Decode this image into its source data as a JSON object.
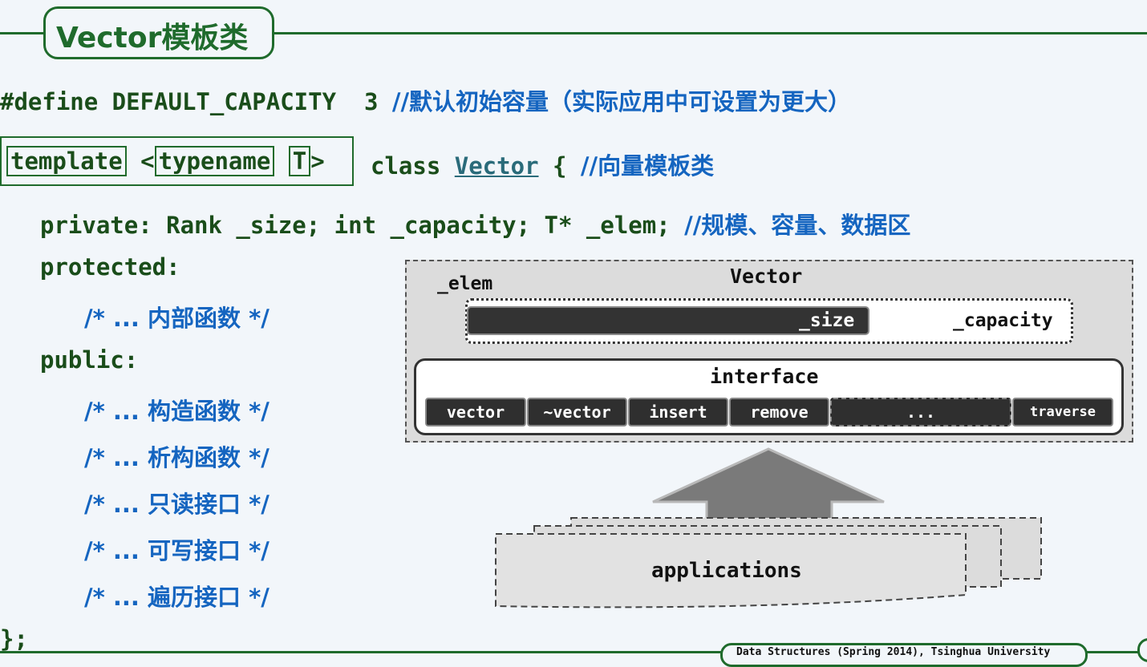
{
  "slide": {
    "title": "Vector模板类",
    "define_code": "#define DEFAULT_CAPACITY  3 ",
    "define_comment": "//默认初始容量（实际应用中可设置为更大）",
    "tpl_template": "template",
    "tpl_lt": "<",
    "tpl_typename": "typename",
    "tpl_T": "T",
    "tpl_gt": ">",
    "class_kw": "class ",
    "class_name": "Vector",
    "class_brace": " { ",
    "class_comment": "//向量模板类",
    "private_code": "private: Rank _size; int _capacity; T* _elem; ",
    "private_comment": "//规模、容量、数据区",
    "protected_kw": "protected:",
    "public_kw": "public:",
    "comment_open": "/* ... ",
    "comment_close": " */",
    "protected_items": [
      "内部函数"
    ],
    "public_items": [
      "构造函数",
      "析构函数",
      "只读接口",
      "可写接口",
      "遍历接口"
    ],
    "closing": "};",
    "footer": "Data Structures (Spring 2014), Tsinghua University"
  },
  "diagram": {
    "title": "Vector",
    "elem_label": "_elem",
    "size_label": "_size",
    "capacity_label": "_capacity",
    "interface_label": "interface",
    "methods": [
      "vector",
      "~vector",
      "insert",
      "remove",
      "...",
      "traverse"
    ],
    "applications_label": "applications"
  },
  "colors": {
    "background": "#f2f6fa",
    "code_green": "#1a4d1a",
    "comment_blue": "#1565c0",
    "frame_green": "#1f6b2c"
  }
}
